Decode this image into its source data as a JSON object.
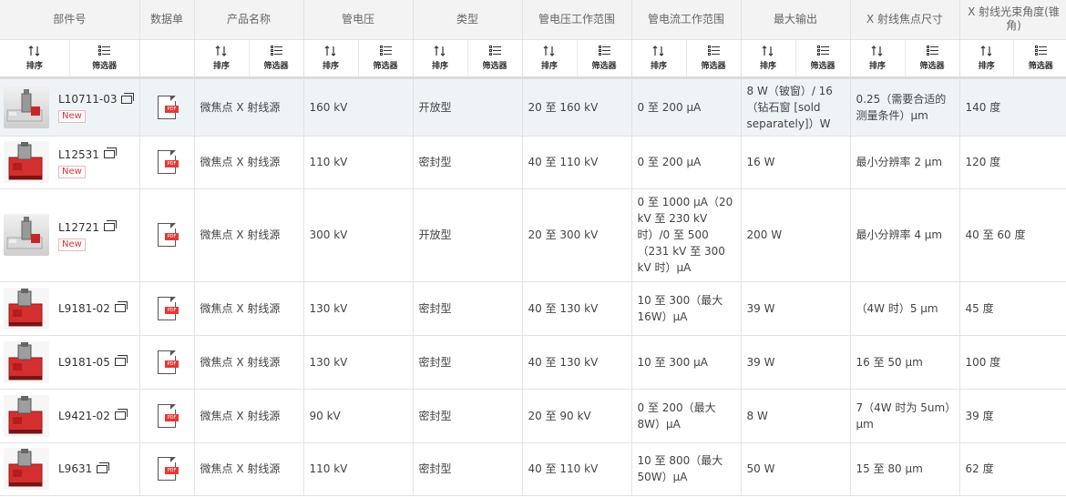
{
  "columns": [
    {
      "key": "part",
      "label": "部件号"
    },
    {
      "key": "datasheet",
      "label": "数据单"
    },
    {
      "key": "name",
      "label": "产品名称"
    },
    {
      "key": "voltage",
      "label": "管电压"
    },
    {
      "key": "type",
      "label": "类型"
    },
    {
      "key": "vrange",
      "label": "管电压工作范围"
    },
    {
      "key": "crange",
      "label": "管电流工作范围"
    },
    {
      "key": "maxout",
      "label": "最大输出"
    },
    {
      "key": "focal",
      "label": "X 射线焦点尺寸"
    },
    {
      "key": "angle",
      "label": "X 射线光束角度(锥角)"
    }
  ],
  "controls": {
    "sort_label": "排序",
    "filter_label": "筛选器",
    "sort_icon": "sort-arrows-icon",
    "filter_icon": "filter-list-icon"
  },
  "badge_new": "New",
  "pdf_tag": "PDF",
  "rows": [
    {
      "part": "L10711-03",
      "new": true,
      "img": "gray",
      "name": "微焦点 X 射线源",
      "voltage": "160 kV",
      "type": "开放型",
      "vrange": "20 至 160 kV",
      "crange": "0 至 200 μA",
      "maxout": "8 W（铍窗）/ 16（钻石窗 [sold separately]）W",
      "focal": "0.25（需要合适的测量条件）μm",
      "angle": "140 度"
    },
    {
      "part": "L12531",
      "new": true,
      "img": "red",
      "name": "微焦点 X 射线源",
      "voltage": "110 kV",
      "type": "密封型",
      "vrange": "40 至 110 kV",
      "crange": "0 至 200 μA",
      "maxout": "16 W",
      "focal": "最小分辨率 2 μm",
      "angle": "120 度"
    },
    {
      "part": "L12721",
      "new": true,
      "img": "gray",
      "name": "微焦点 X 射线源",
      "voltage": "300 kV",
      "type": "开放型",
      "vrange": "20 至 300 kV",
      "crange": "0 至 1000 μA（20 kV 至 230 kV 时）/0 至 500（231 kV 至 300 kV 时）μA",
      "maxout": "200 W",
      "focal": "最小分辨率 4 μm",
      "angle": "40 至 60 度"
    },
    {
      "part": "L9181-02",
      "new": false,
      "img": "red",
      "name": "微焦点 X 射线源",
      "voltage": "130 kV",
      "type": "密封型",
      "vrange": "40 至 130 kV",
      "crange": "10 至 300（最大 16W）μA",
      "maxout": "39 W",
      "focal": "（4W 时）5 μm",
      "angle": "45 度"
    },
    {
      "part": "L9181-05",
      "new": false,
      "img": "red",
      "name": "微焦点 X 射线源",
      "voltage": "130 kV",
      "type": "密封型",
      "vrange": "40 至 130 kV",
      "crange": "10 至 300 μA",
      "maxout": "39 W",
      "focal": "16 至 50 μm",
      "angle": "100 度"
    },
    {
      "part": "L9421-02",
      "new": false,
      "img": "red",
      "name": "微焦点 X 射线源",
      "voltage": "90 kV",
      "type": "密封型",
      "vrange": "20 至 90 kV",
      "crange": "0 至 200（最大 8W）μA",
      "maxout": "8 W",
      "focal": "7（4W 时为 5um）μm",
      "angle": "39 度"
    },
    {
      "part": "L9631",
      "new": false,
      "img": "red",
      "name": "微焦点 X 射线源",
      "voltage": "110 kV",
      "type": "密封型",
      "vrange": "40 至 110 kV",
      "crange": "10 至 800（最大 50W）μA",
      "maxout": "50 W",
      "focal": "15 至 80 μm",
      "angle": "62 度"
    }
  ],
  "colors": {
    "header_bg": "#f3f3f3",
    "highlight_row": "#eef4f6",
    "new_badge": "#e0302f",
    "pdf_red": "#e53935",
    "product_red": "#d32f2f"
  }
}
